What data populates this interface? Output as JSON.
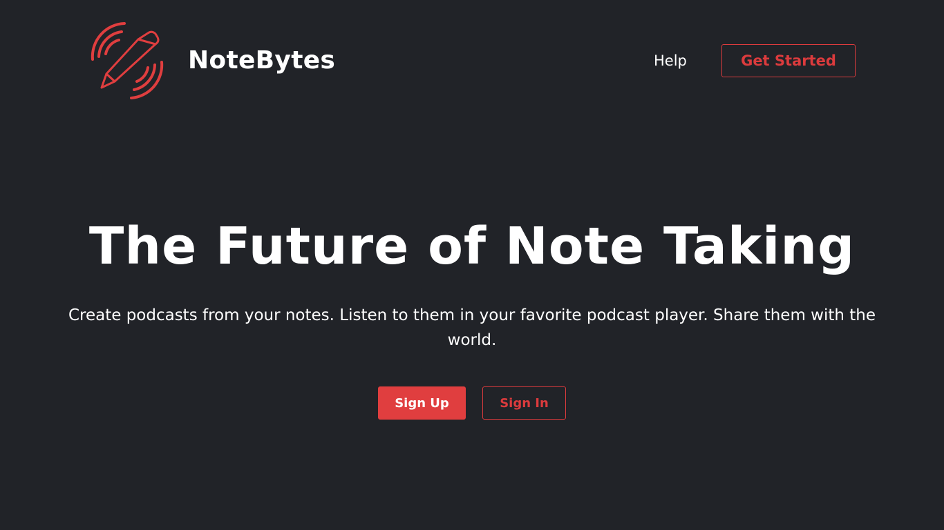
{
  "header": {
    "logo_icon": "pencil-sound-waves-icon",
    "brand_name": "NoteBytes",
    "nav": {
      "help_label": "Help",
      "get_started_label": "Get Started"
    }
  },
  "hero": {
    "title": "The Future of Note Taking",
    "subtitle": "Create podcasts from your notes. Listen to them in your favorite podcast player. Share them with the world.",
    "sign_up_label": "Sign Up",
    "sign_in_label": "Sign In"
  },
  "colors": {
    "background": "#212328",
    "accent": "#e03e3f",
    "text": "#ffffff"
  }
}
